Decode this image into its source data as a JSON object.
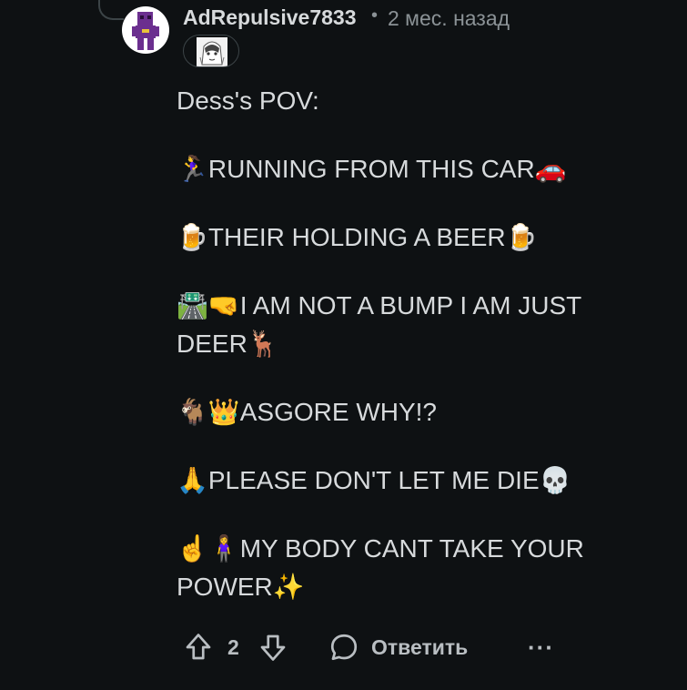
{
  "comment": {
    "author": "AdRepulsive7833",
    "separator": "•",
    "time": "2 мес. назад",
    "body": [
      "Dess's POV:",
      "🏃‍♀️RUNNING FROM THIS CAR🚗",
      "🍺THEIR HOLDING A BEER🍺",
      "🛣️🤜I AM NOT A BUMP I AM JUST DEER🦌",
      "🐐👑ASGORE WHY!?",
      "🙏PLEASE DON'T LET ME DIE💀",
      "☝️🧍‍♀️MY BODY CANT TAKE YOUR POWER✨"
    ]
  },
  "actions": {
    "vote_count": "2",
    "reply_label": "Ответить",
    "more_label": "···"
  },
  "icons": {
    "upvote": "arrow-up-icon",
    "downvote": "arrow-down-icon",
    "reply": "speech-bubble-icon",
    "more": "more-dots-icon"
  },
  "colors": {
    "background": "#0e1113",
    "text": "#d7dadc",
    "muted": "#8b9296",
    "avatar_figure": "#6b2f8f"
  }
}
